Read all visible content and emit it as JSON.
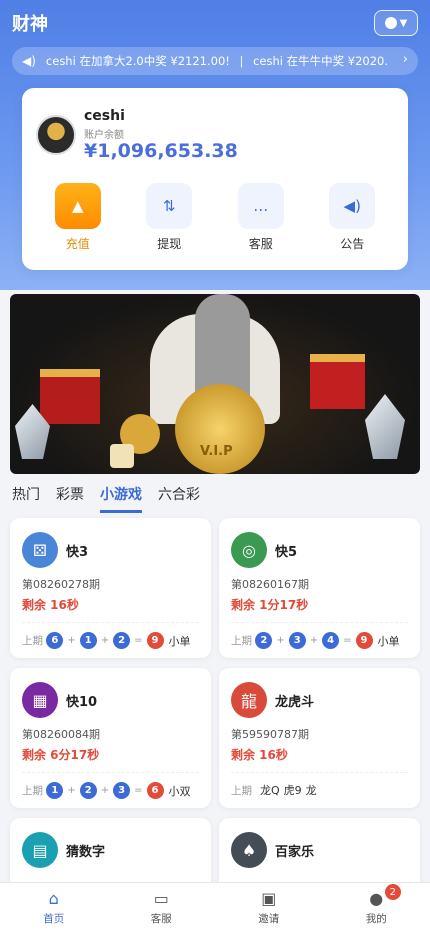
{
  "header": {
    "title": "财神"
  },
  "ticker": {
    "items": [
      "ceshi 在加拿大2.0中奖 ¥2121.00!",
      "ceshi 在牛牛中奖 ¥2020."
    ]
  },
  "account": {
    "username": "ceshi",
    "balance_label": "账户余额",
    "balance": "¥1,096,653.38",
    "actions": [
      {
        "label": "充值",
        "icon": "upload-icon"
      },
      {
        "label": "提现",
        "icon": "withdraw-icon"
      },
      {
        "label": "客服",
        "icon": "chat-icon"
      },
      {
        "label": "公告",
        "icon": "speaker-icon"
      }
    ]
  },
  "banner": {
    "vip_text": "V.I.P"
  },
  "tabs": [
    "热门",
    "彩票",
    "小游戏",
    "六合彩"
  ],
  "active_tab": "小游戏",
  "last_label": "上期",
  "games": [
    {
      "name": "快3",
      "period": "第08260278期",
      "remaining": "剩余 16秒",
      "balls": [
        "6",
        "1",
        "2"
      ],
      "sum": "9",
      "result": "小单",
      "icon_color": "#4a86d8"
    },
    {
      "name": "快5",
      "period": "第08260167期",
      "remaining": "剩余 1分17秒",
      "balls": [
        "2",
        "3",
        "4"
      ],
      "sum": "9",
      "result": "小单",
      "icon_color": "#3a9a52"
    },
    {
      "name": "快10",
      "period": "第08260084期",
      "remaining": "剩余 6分17秒",
      "balls": [
        "1",
        "2",
        "3"
      ],
      "sum": "6",
      "result": "小双",
      "icon_color": "#7a2aa0"
    },
    {
      "name": "龙虎斗",
      "period": "第59590787期",
      "remaining": "剩余 16秒",
      "dragon": "龙Q",
      "tiger": "虎9",
      "result": "龙",
      "icon_color": "#d84a3a"
    },
    {
      "name": "猜数字",
      "icon_color": "#1aa0b0"
    },
    {
      "name": "百家乐",
      "icon_color": "#444c55"
    }
  ],
  "bottom_nav": [
    {
      "label": "首页",
      "icon": "home-icon"
    },
    {
      "label": "客服",
      "icon": "chat-icon"
    },
    {
      "label": "邀请",
      "icon": "gift-icon"
    },
    {
      "label": "我的",
      "icon": "user-icon",
      "badge": "2"
    }
  ]
}
